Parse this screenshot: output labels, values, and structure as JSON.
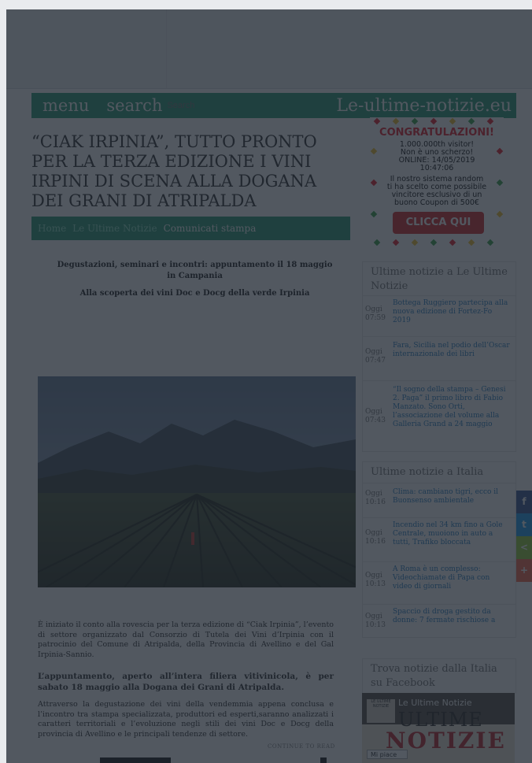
{
  "nav": {
    "menu_label": "menu",
    "search_label": "search",
    "search_placeholder": "Search",
    "brand": "Le-ultime-notizie.eu"
  },
  "article": {
    "headline": "“CIAK IRPINIA”, TUTTO PRONTO PER LA TERZA EDIZIONE I VINI IRPINI DI SCENA ALLA DOGANA DEI GRANI DI ATRIPALDA",
    "breadcrumb": [
      "Home",
      "Le Ultime Notizie",
      "Comunicati stampa"
    ],
    "lead_1": "Degustazioni, seminari e incontri: appuntamento il 18 maggio in Campania",
    "lead_2": "Alla scoperta dei vini Doc e Docg della verde Irpinia",
    "p1": "È iniziato il conto alla rovescia per la terza edizione di “Ciak Irpinia”, l’evento di settore organizzato dal Consorzio di Tutela dei Vini d’Irpinia con il patrocinio del Comune di Atripalda, della Provincia di Avellino e del Gal Irpinia-Sannio.",
    "p2": "L’appuntamento, aperto all’intera filiera vitivinicola, è per sabato 18 maggio alla Dogana dei Grani di Atripalda.",
    "p3": "Attraverso la degustazione dei vini della vendemmia appena conclusa e l’incontro tra stampa specializzata, produttori ed esperti,saranno analizzati i caratteri territoriali e l’evoluzione negli stili dei vini Doc e Docg della provincia di Avellino e le principali tendenze di settore.",
    "footnote": "CONTINUE TO READ"
  },
  "promo": {
    "title": "CONGRATULAZIONI!",
    "lines": [
      "1.000.000th visitor!",
      "Non è uno scherzo!",
      "ONLINE: 14/05/2019",
      "10:47:06",
      "Il nostro sistema random",
      "ti ha scelto come possibile",
      "vincitore esclusivo di un",
      "buono Coupon di 500€"
    ],
    "button": "CLICCA QUI"
  },
  "widget_site": {
    "title": "Ultime notizie a Le Ultime Notizie",
    "items": [
      {
        "date": "Oggi 07:59",
        "text": "Bottega Ruggiero partecipa alla nuova edizione di Fortez-Fo 2019"
      },
      {
        "date": "Oggi 07:47",
        "text": "Fara, Sicilia nel podio dell’Oscar internazionale dei libri"
      },
      {
        "date": "Oggi 07:43",
        "text": "“Il sogno della stampa – Genesi 2. Paga” il primo libro di Fabio Manzato. Sono Orti, l’associazione del volume alla Galleria Grand a 24 maggio"
      }
    ]
  },
  "widget_italy": {
    "title": "Ultime notizie a Italia",
    "items": [
      {
        "date": "Oggi 10:16",
        "text": "Clima: cambiano tigri, ecco il Buonsenso ambientale"
      },
      {
        "date": "Oggi 10:16",
        "text": "Incendio nel 34 km fino a Gole Centrale, muoiono in auto a tutti, Trafiko bloccata"
      },
      {
        "date": "Oggi 10:13",
        "text": "A Roma è un complesso: Videochiamate di Papa con video di giornali"
      },
      {
        "date": "Oggi 10:13",
        "text": "Spaccio di droga gestito da donne: 7 fermate rischiose a"
      }
    ]
  },
  "widget_fb": {
    "title": "Trova notizie dalla Italia su Facebook",
    "page_name": "Le Ultime Notizie",
    "logo_text": "LE ULTIME NOTIZIE",
    "mast_1": "ULTIME",
    "mast_2": "NOTIZIE",
    "like_label": "Mi piace"
  },
  "share": {
    "buttons": [
      {
        "icon": "facebook-icon",
        "glyph": "f",
        "color": "#3b5998"
      },
      {
        "icon": "twitter-icon",
        "glyph": "t",
        "color": "#1da1f2"
      },
      {
        "icon": "share-icon",
        "glyph": "<",
        "color": "#95d03a"
      },
      {
        "icon": "plus-icon",
        "glyph": "+",
        "color": "#f8694d"
      }
    ]
  },
  "colors": {
    "accent": "#2c9b77",
    "overlay": "#1c242e",
    "promo_red": "#e41d2b"
  }
}
